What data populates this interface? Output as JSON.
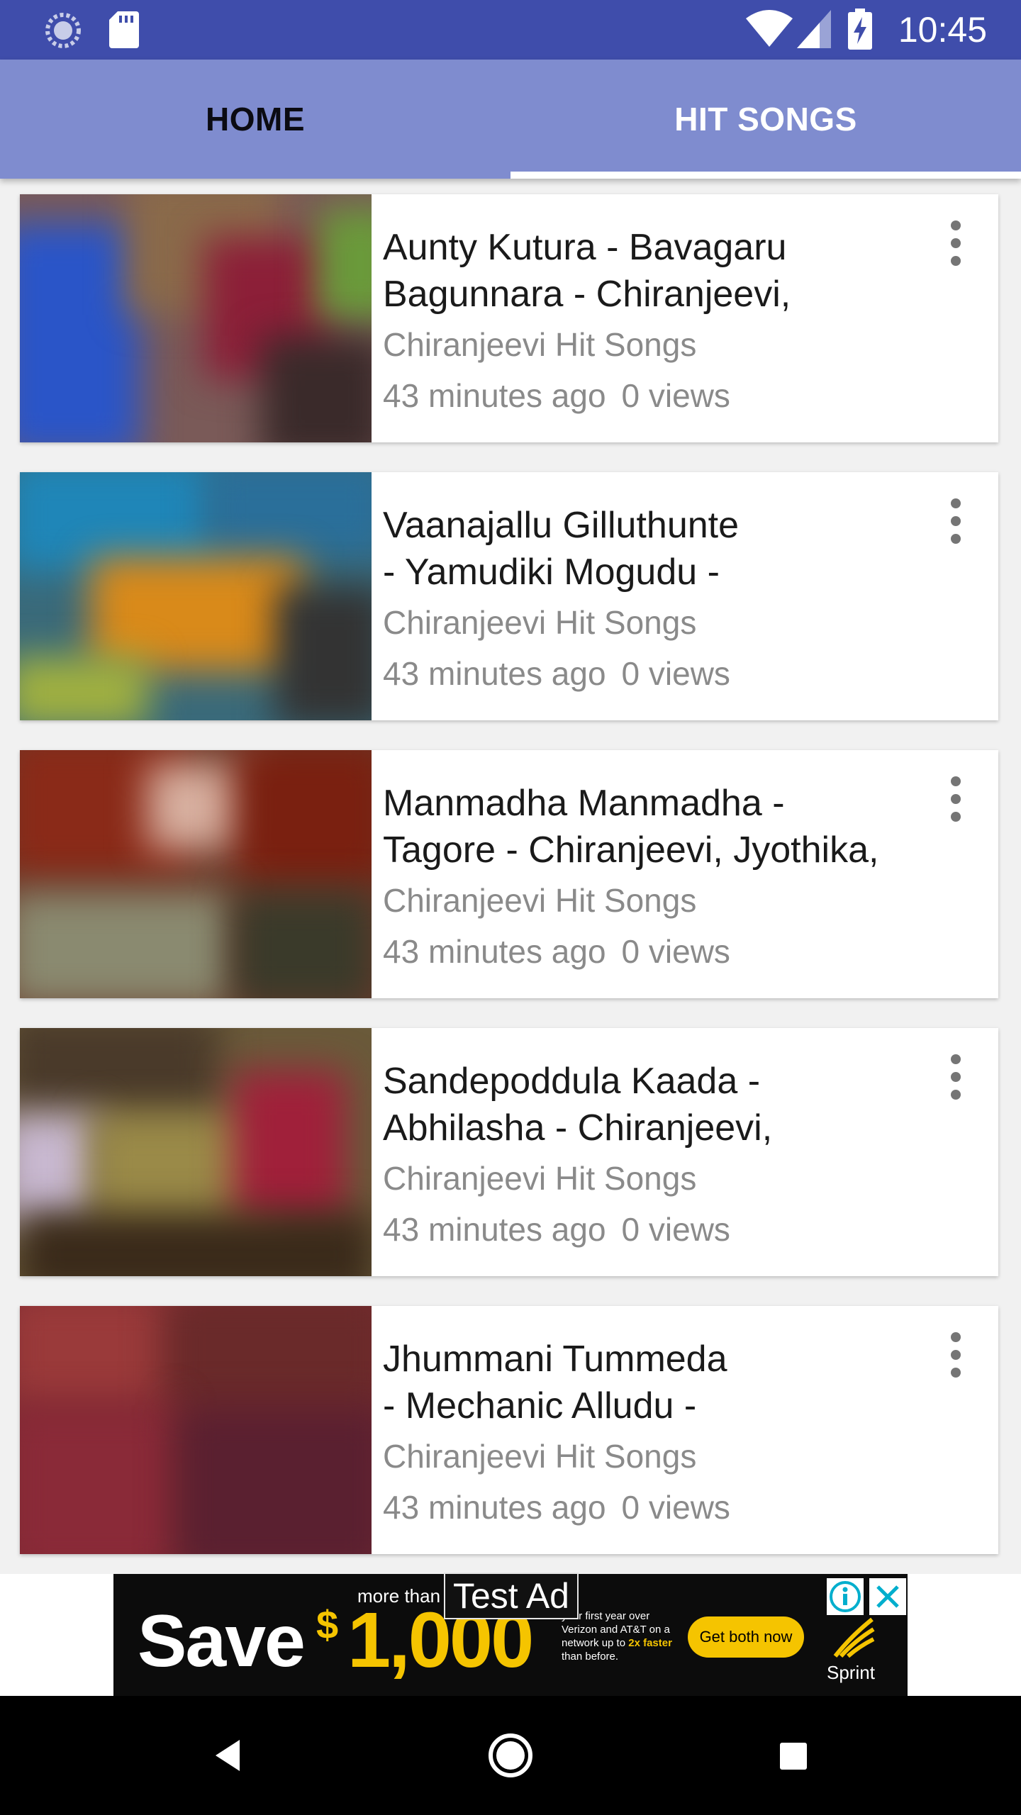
{
  "status_bar": {
    "time": "10:45",
    "icons": [
      "sync-icon",
      "sd-card-icon",
      "wifi-icon",
      "cell-signal-icon",
      "battery-charging-icon"
    ]
  },
  "tabs": [
    {
      "label": "HOME",
      "selected": false
    },
    {
      "label": "HIT SONGS",
      "selected": true
    }
  ],
  "videos": [
    {
      "title": "Aunty Kutura - Bavagaru\nBagunnara - Chiranjeevi,",
      "channel": "Chiranjeevi Hit Songs",
      "time": "43 minutes ago",
      "views": "0 views"
    },
    {
      "title": "Vaanajallu Gilluthunte\n- Yamudiki Mogudu -",
      "channel": "Chiranjeevi Hit Songs",
      "time": "43 minutes ago",
      "views": "0 views"
    },
    {
      "title": "Manmadha Manmadha -\nTagore - Chiranjeevi, Jyothika,",
      "channel": "Chiranjeevi Hit Songs",
      "time": "43 minutes ago",
      "views": "0 views"
    },
    {
      "title": "Sandepoddula Kaada -\nAbhilasha - Chiranjeevi,",
      "channel": "Chiranjeevi Hit Songs",
      "time": "43 minutes ago",
      "views": "0 views"
    },
    {
      "title": "Jhummani Tummeda\n- Mechanic Alludu -",
      "channel": "Chiranjeevi Hit Songs",
      "time": "43 minutes ago",
      "views": "0 views"
    }
  ],
  "ad": {
    "label": "Test Ad",
    "more_than": "more than",
    "save": "Save",
    "dollar": "$",
    "amount": "1,000",
    "fine_print_1": "your first year over Verizon and AT&T on a network up to",
    "fine_print_highlight": "2x faster",
    "fine_print_2": "than before.",
    "cta": "Get both now",
    "brand": "Sprint"
  },
  "nav": {
    "icons": [
      "back-icon",
      "home-icon",
      "recents-icon"
    ]
  },
  "colors": {
    "status_bar": "#3f4dab",
    "tab_bar": "#7f8ccf",
    "ad_accent": "#f5c400"
  }
}
